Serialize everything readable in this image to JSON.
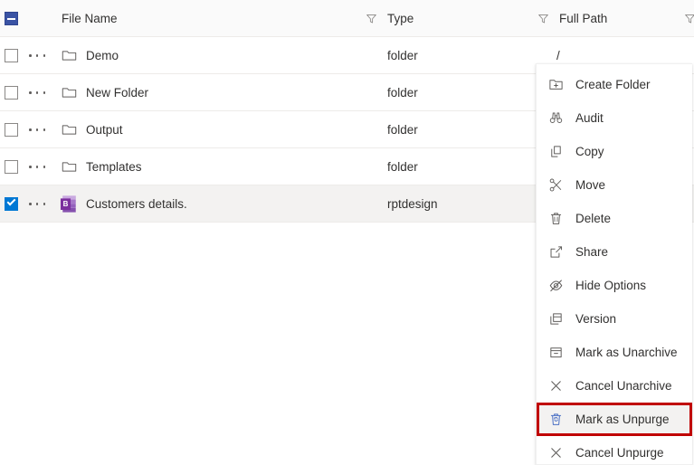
{
  "header": {
    "select_all_state": "indeterminate",
    "columns": [
      {
        "label": "File Name",
        "has_filter": false
      },
      {
        "label": "Type",
        "has_filter": true,
        "icon": "filter-icon"
      },
      {
        "label": "Full Path",
        "has_filter": true,
        "icon": "filter-icon"
      },
      {
        "label": "",
        "has_filter": true,
        "icon": "filter-icon"
      }
    ]
  },
  "rows": [
    {
      "checked": false,
      "icon": "folder-icon",
      "name": "Demo",
      "type": "folder",
      "path": "/"
    },
    {
      "checked": false,
      "icon": "folder-icon",
      "name": "New Folder",
      "type": "folder",
      "path": ""
    },
    {
      "checked": false,
      "icon": "folder-icon",
      "name": "Output",
      "type": "folder",
      "path": ""
    },
    {
      "checked": false,
      "icon": "folder-icon",
      "name": "Templates",
      "type": "folder",
      "path": ""
    },
    {
      "checked": true,
      "icon": "rptdesign-file-icon",
      "name": "Customers details.",
      "type": "rptdesign",
      "path": ""
    }
  ],
  "context_menu": {
    "items": [
      {
        "label": "Create Folder",
        "icon": "folder-add-icon",
        "highlighted": false
      },
      {
        "label": "Audit",
        "icon": "binoculars-icon",
        "highlighted": false
      },
      {
        "label": "Copy",
        "icon": "copy-icon",
        "highlighted": false
      },
      {
        "label": "Move",
        "icon": "scissors-icon",
        "highlighted": false
      },
      {
        "label": "Delete",
        "icon": "trash-icon",
        "highlighted": false
      },
      {
        "label": "Share",
        "icon": "share-icon",
        "highlighted": false
      },
      {
        "label": "Hide Options",
        "icon": "eye-slash-icon",
        "highlighted": false
      },
      {
        "label": "Version",
        "icon": "version-stack-icon",
        "highlighted": false
      },
      {
        "label": "Mark as Unarchive",
        "icon": "archive-box-icon",
        "highlighted": false
      },
      {
        "label": "Cancel Unarchive",
        "icon": "cancel-x-icon",
        "highlighted": false
      },
      {
        "label": "Mark as Unpurge",
        "icon": "trash-restore-icon",
        "highlighted": true
      },
      {
        "label": "Cancel Unpurge",
        "icon": "cancel-x-icon",
        "highlighted": false
      }
    ]
  },
  "colors": {
    "selection_blue": "#0078d4",
    "select_all_navy": "#3a53a4",
    "highlight_red": "#c00000",
    "row_selected_bg": "#f3f2f1",
    "header_bg": "#fafafa",
    "divider": "#edebe9",
    "text": "#323130",
    "icon_gray": "#605e5c",
    "birt_purple": "#7b2f9e"
  }
}
